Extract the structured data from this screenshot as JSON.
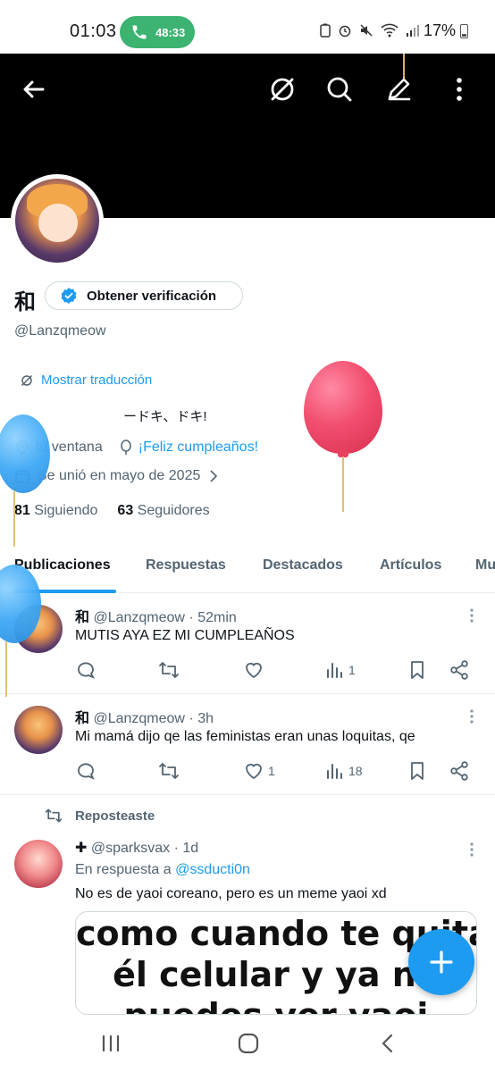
{
  "status_bar": {
    "time": "01:03",
    "call_timer": "48:33",
    "battery": "17%"
  },
  "profile": {
    "name": "和",
    "verify_label": "Obtener verificación",
    "handle": "@Lanzqmeow",
    "translate_label": "Mostrar traducción",
    "bio": "ードキ、ドキ!",
    "location": "tu ventana",
    "birthday": "¡Feliz cumpleaños!",
    "joined": "Se unió en mayo de 2025",
    "following_count": "81",
    "following_label": "Siguiendo",
    "followers_count": "63",
    "followers_label": "Seguidores"
  },
  "tabs": [
    "Publicaciones",
    "Respuestas",
    "Destacados",
    "Artículos",
    "Mu"
  ],
  "tweets": [
    {
      "name": "和",
      "handle": "@Lanzqmeow",
      "time": "· 52min",
      "text": "MUTIS AYA EZ MI CUMPLEAÑOS",
      "likes": "",
      "views": "1"
    },
    {
      "name": "和",
      "handle": "@Lanzqmeow",
      "time": "· 3h",
      "text": "Mi mamá dijo qe las feministas eran unas loquitas, qe",
      "likes": "1",
      "views": "18"
    },
    {
      "retweet_label": "Reposteaste",
      "name": "✚",
      "handle": "@sparksvax",
      "time": "· 1d",
      "reply_prefix": "En respuesta a",
      "reply_to": "@ssducti0n",
      "text": "No es de yaoi coreano, pero es un meme yaoi xd",
      "meme_lines": [
        "como cuando te quitan",
        "él celular y ya no",
        "puedes ver yaoi"
      ]
    }
  ],
  "colors": {
    "accent": "#1d9bf0",
    "text": "#0f1419",
    "muted": "#536471",
    "banner": "#000000",
    "call": "#3cb371"
  },
  "icons": [
    "back-arrow-icon",
    "translate-icon",
    "search-icon",
    "edit-icon",
    "more-vert-icon",
    "verified-badge-icon",
    "location-icon",
    "balloon-icon",
    "calendar-icon",
    "chevron-right-icon",
    "reply-icon",
    "retweet-icon",
    "like-icon",
    "views-icon",
    "bookmark-icon",
    "share-icon",
    "plus-icon"
  ]
}
